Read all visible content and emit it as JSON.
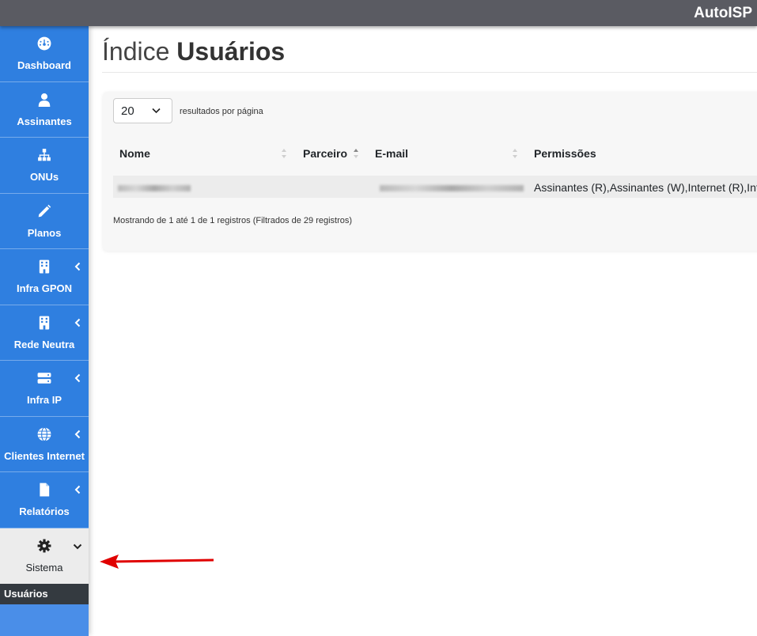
{
  "app": {
    "brand": "AutoISP"
  },
  "sidebar": {
    "items": [
      {
        "label": "Dashboard",
        "icon": "gauge-icon",
        "chevron": ""
      },
      {
        "label": "Assinantes",
        "icon": "user-icon",
        "chevron": ""
      },
      {
        "label": "ONUs",
        "icon": "sitemap-icon",
        "chevron": ""
      },
      {
        "label": "Planos",
        "icon": "pencil-icon",
        "chevron": ""
      },
      {
        "label": "Infra GPON",
        "icon": "building-icon",
        "chevron": "left"
      },
      {
        "label": "Rede Neutra",
        "icon": "building-icon",
        "chevron": "left"
      },
      {
        "label": "Infra IP",
        "icon": "server-icon",
        "chevron": "left"
      },
      {
        "label": "Clientes Internet",
        "icon": "globe-icon",
        "chevron": "left"
      },
      {
        "label": "Relatórios",
        "icon": "file-icon",
        "chevron": "left"
      },
      {
        "label": "Sistema",
        "icon": "gear-icon",
        "chevron": "down",
        "active": true
      }
    ],
    "submenu": [
      {
        "label": "Usuários",
        "active": true
      }
    ]
  },
  "page": {
    "title_light": "Índice",
    "title_bold": "Usuários"
  },
  "table": {
    "per_page_value": "20",
    "per_page_label": "resultados por página",
    "columns": [
      "Nome",
      "Parceiro",
      "E-mail",
      "Permissões"
    ],
    "rows": [
      {
        "nome": "",
        "parceiro": "",
        "email": "",
        "permissoes": "Assinantes (R),Assinantes (W),Internet (R),Internet (W)"
      }
    ],
    "info": "Mostrando de 1 até 1 de 1 registros (Filtrados de 29 registros)"
  },
  "colors": {
    "topbar": "#5a5b62",
    "sidebar": "#2f7fe0",
    "active_item": "#ececec",
    "submenu": "#343a40",
    "annotation_arrow": "#e00000"
  }
}
